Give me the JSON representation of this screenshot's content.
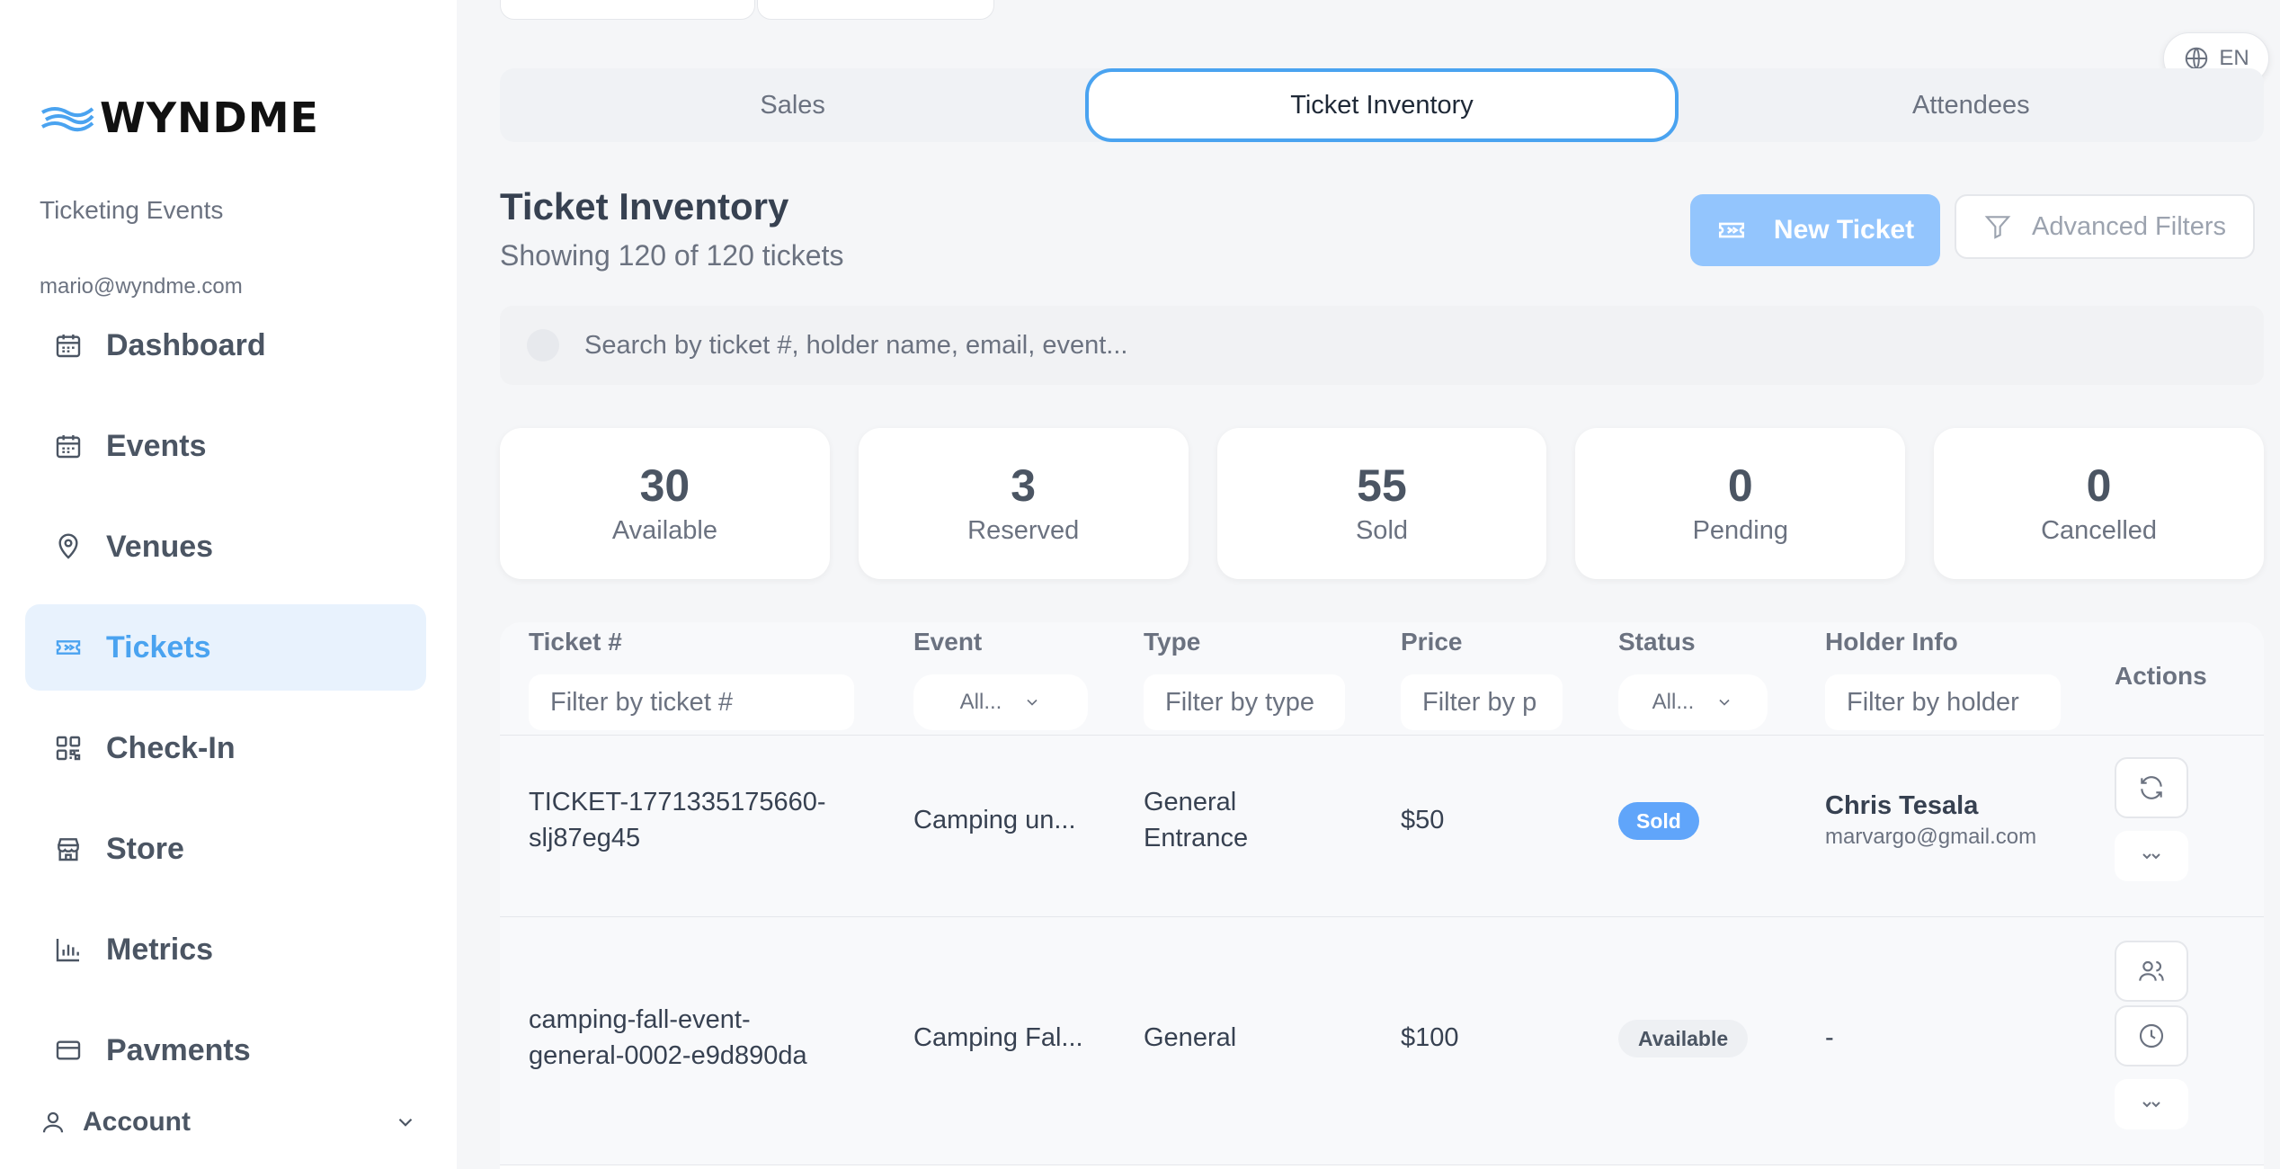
{
  "brand": {
    "name": "WYNDME"
  },
  "sidebar": {
    "app_name": "Ticketing Events",
    "user_email": "mario@wyndme.com",
    "items": [
      {
        "label": "Dashboard",
        "icon": "calendar-icon"
      },
      {
        "label": "Events",
        "icon": "calendar-icon"
      },
      {
        "label": "Venues",
        "icon": "map-pin-icon"
      },
      {
        "label": "Tickets",
        "icon": "ticket-icon",
        "active": true
      },
      {
        "label": "Check-In",
        "icon": "qr-code-icon"
      },
      {
        "label": "Store",
        "icon": "store-icon"
      },
      {
        "label": "Metrics",
        "icon": "bar-chart-icon"
      },
      {
        "label": "Pavments",
        "icon": "credit-card-icon"
      }
    ],
    "account_label": "Account"
  },
  "lang": {
    "label": "EN"
  },
  "tabs": [
    {
      "label": "Sales"
    },
    {
      "label": "Ticket Inventory",
      "active": true
    },
    {
      "label": "Attendees"
    }
  ],
  "page": {
    "title": "Ticket Inventory",
    "subtitle": "Showing 120 of 120 tickets",
    "new_ticket_label": "New Ticket",
    "advanced_filters_label": "Advanced Filters",
    "search_placeholder": "Search by ticket #, holder name, email, event..."
  },
  "stats": [
    {
      "value": "30",
      "label": "Available"
    },
    {
      "value": "3",
      "label": "Reserved"
    },
    {
      "value": "55",
      "label": "Sold"
    },
    {
      "value": "0",
      "label": "Pending"
    },
    {
      "value": "0",
      "label": "Cancelled"
    }
  ],
  "table": {
    "columns": {
      "ticket": {
        "label": "Ticket #",
        "filter_placeholder": "Filter by ticket #"
      },
      "event": {
        "label": "Event",
        "filter_value": "All..."
      },
      "type": {
        "label": "Type",
        "filter_placeholder": "Filter by type"
      },
      "price": {
        "label": "Price",
        "filter_placeholder": "Filter by p"
      },
      "status": {
        "label": "Status",
        "filter_value": "All..."
      },
      "holder": {
        "label": "Holder Info",
        "filter_placeholder": "Filter by holder"
      },
      "actions": {
        "label": "Actions"
      }
    },
    "rows": [
      {
        "ticket_line1": "TICKET-1771335175660-",
        "ticket_line2": "slj87eg45",
        "event": "Camping un...",
        "type_line1": "General",
        "type_line2": "Entrance",
        "price": "$50",
        "status": "Sold",
        "holder_name": "Chris Tesala",
        "holder_email": "marvargo@gmail.com"
      },
      {
        "ticket_line1": "camping-fall-event-",
        "ticket_line2": "general-0002-e9d890da",
        "event": "Camping Fal...",
        "type_line1": "General",
        "type_line2": "",
        "price": "$100",
        "status": "Available",
        "holder_name": "-",
        "holder_email": ""
      }
    ]
  },
  "colors": {
    "accent": "#4aa3f0",
    "button_primary": "#93c5fd",
    "active_nav_bg": "#e8f2fd",
    "badge_sold": "#60a5fa"
  }
}
